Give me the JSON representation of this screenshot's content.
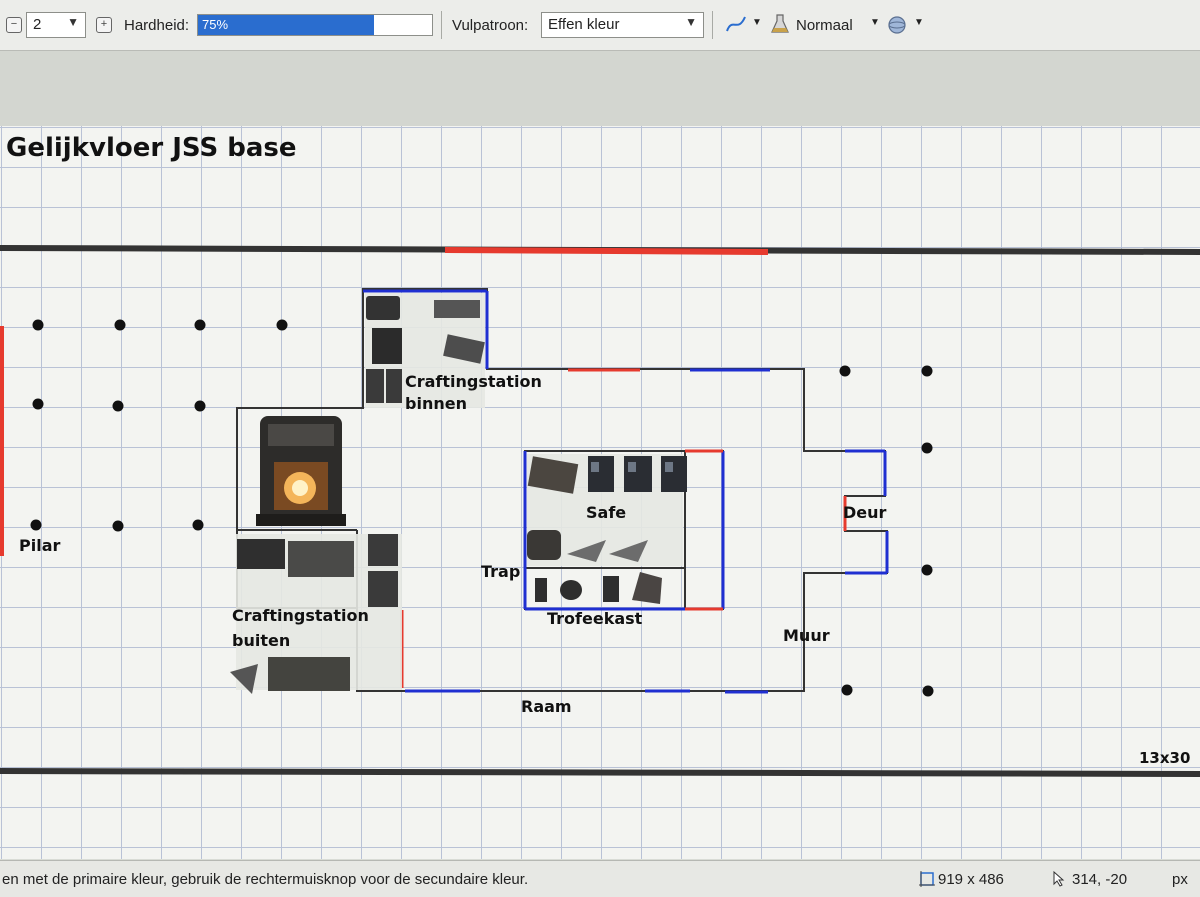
{
  "toolbar": {
    "brush_minus_icon": "minus-circle-icon",
    "brush_size": "2",
    "brush_plus_icon": "plus-circle-icon",
    "hardness_label": "Hardheid:",
    "hardness_value_text": "75%",
    "hardness_value": 0.75,
    "fill_label": "Vulpatroon:",
    "fill_value": "Effen kleur",
    "antialias_icon": "curve-icon",
    "blend_icon": "flask-icon",
    "blend_mode": "Normaal",
    "alpha_icon": "sphere-icon"
  },
  "canvas": {
    "title": "Gelijkvloer JSS base",
    "labels": {
      "craft_in_1": "Craftingstation",
      "craft_in_2": "binnen",
      "safe": "Safe",
      "trap": "Trap",
      "trophy": "Trofeekast",
      "door": "Deur",
      "pillar": "Pilar",
      "craft_out_1": "Craftingstation",
      "craft_out_2": "buiten",
      "wall": "Muur",
      "window": "Raam",
      "size": "13x30"
    },
    "colors": {
      "wall": "#3a3a3a",
      "window_blue": "#1f2fd1",
      "door_red": "#e63a2e",
      "outline": "#1a1a1a"
    }
  },
  "status": {
    "hint": "en met de primaire kleur, gebruik de rechtermuisknop voor de secundaire kleur.",
    "image_size": "919 x 486",
    "cursor_pos": "314, -20",
    "unit": "px"
  }
}
